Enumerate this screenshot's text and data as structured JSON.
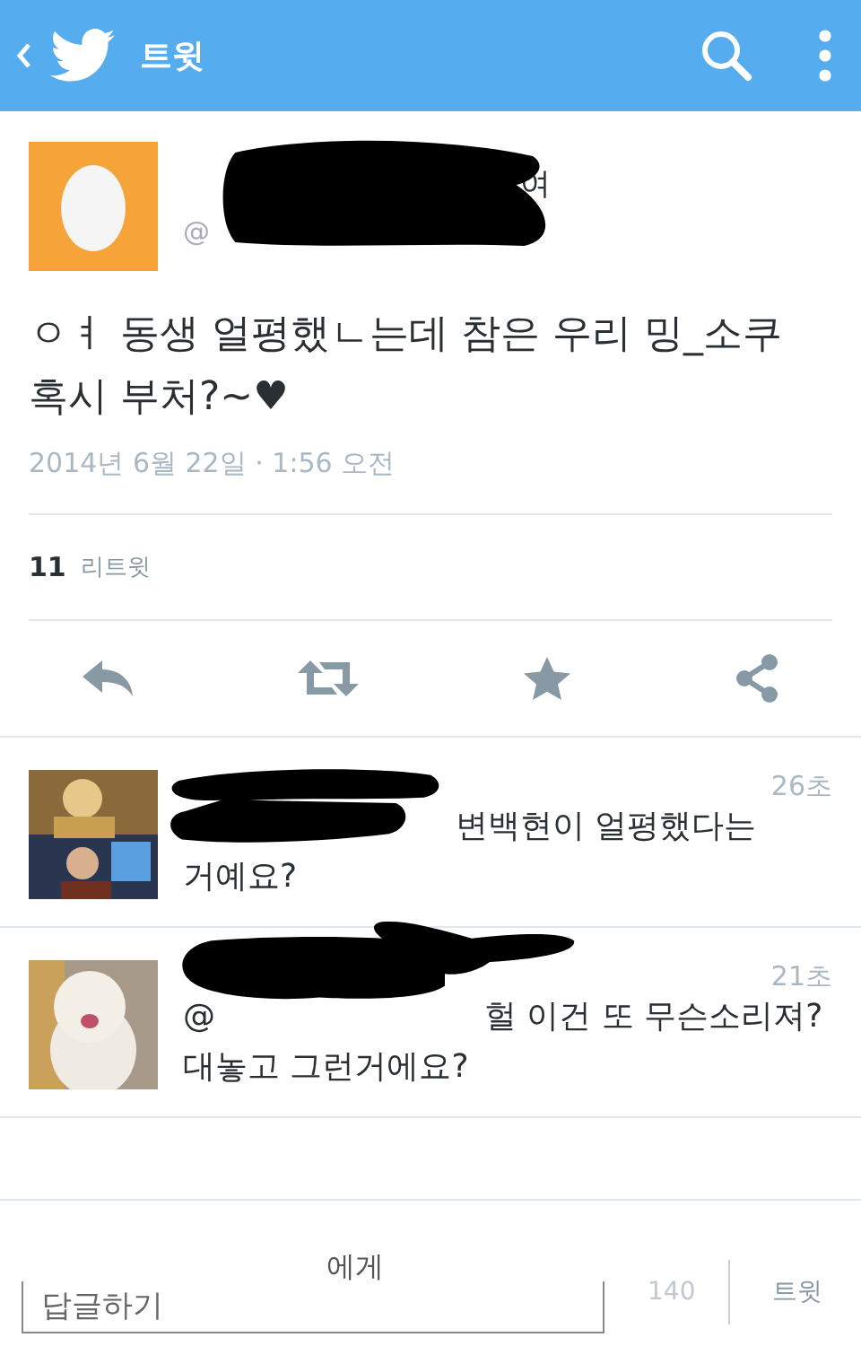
{
  "header": {
    "title": "트윗"
  },
  "author": {
    "name_fragment": "여",
    "handle_fragment": "@"
  },
  "tweet": {
    "lines": [
      "ㅇㅕ 동생 얼평했ㄴ는데 참은 우리 밍_소쿠",
      "혹시 부처?~♥"
    ],
    "date": "2014년 6월 22일 · 1:56 오전"
  },
  "stats": {
    "count": "11",
    "label": "리트윗"
  },
  "replies": [
    {
      "time": "26초",
      "lines": [
        [
          "변백현이 얼평했다는"
        ],
        [
          "거예요?"
        ]
      ],
      "kind": "double"
    },
    {
      "time": "21초",
      "lines": [
        [
          "@",
          "헐 이건 또 무슨소리져?"
        ],
        [
          "대놓고 그런거에요?"
        ]
      ],
      "kind": "swirl"
    }
  ],
  "composer": {
    "reply_to": "에게",
    "placeholder": "답글하기",
    "counter": "140",
    "button": "트윗"
  }
}
